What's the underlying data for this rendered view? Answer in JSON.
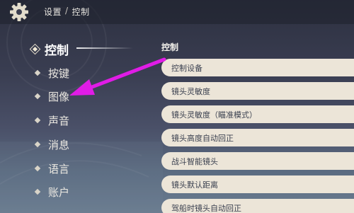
{
  "header": {
    "breadcrumb": [
      "设置",
      "/",
      "控制"
    ]
  },
  "sidebar": {
    "items": [
      {
        "label": "控制",
        "active": true
      },
      {
        "label": "按键"
      },
      {
        "label": "图像"
      },
      {
        "label": "声音"
      },
      {
        "label": "消息"
      },
      {
        "label": "语言"
      },
      {
        "label": "账户"
      }
    ]
  },
  "main": {
    "section_title": "控制",
    "options": [
      "控制设备",
      "镜头灵敏度",
      "镜头灵敏度（瞄准模式）",
      "镜头高度自动回正",
      "战斗智能镜头",
      "镜头默认距离",
      "驾船时镜头自动回正"
    ]
  },
  "colors": {
    "annotation_arrow": "#e01ce6",
    "option_bg": "#ece5d8",
    "option_text": "#3b4150"
  },
  "icons": {
    "settings": "gear-icon",
    "annotation": "arrow-annotation"
  }
}
